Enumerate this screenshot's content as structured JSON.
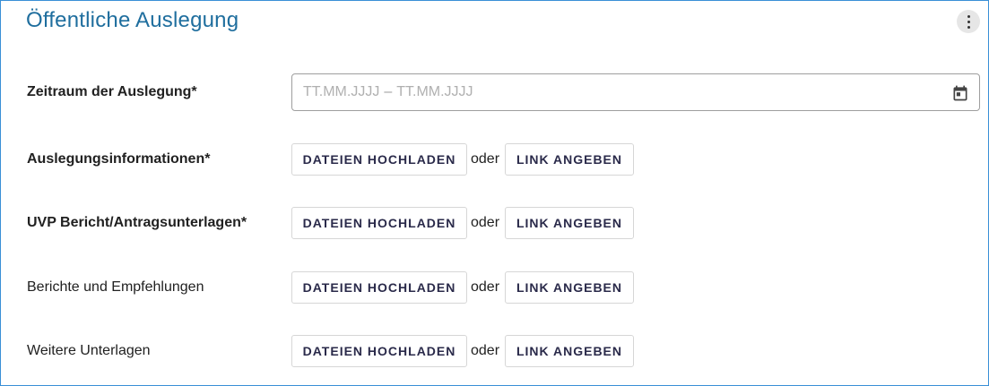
{
  "section": {
    "title": "Öffentliche Auslegung",
    "menu_icon": "more-vert-icon"
  },
  "period": {
    "label": "Zeitraum der Auslegung*",
    "start_placeholder": "TT.MM.JJJJ",
    "separator": "–",
    "end_placeholder": "TT.MM.JJJJ",
    "icon": "calendar-icon"
  },
  "uploads": [
    {
      "label": "Auslegungsinformationen*",
      "required": true,
      "upload_label": "DATEIEN HOCHLADEN",
      "or_label": "oder",
      "link_label": "LINK ANGEBEN"
    },
    {
      "label": "UVP Bericht/Antragsunterlagen*",
      "required": true,
      "upload_label": "DATEIEN HOCHLADEN",
      "or_label": "oder",
      "link_label": "LINK ANGEBEN"
    },
    {
      "label": "Berichte und Empfehlungen",
      "required": false,
      "upload_label": "DATEIEN HOCHLADEN",
      "or_label": "oder",
      "link_label": "LINK ANGEBEN"
    },
    {
      "label": "Weitere Unterlagen",
      "required": false,
      "upload_label": "DATEIEN HOCHLADEN",
      "or_label": "oder",
      "link_label": "LINK ANGEBEN"
    }
  ],
  "colors": {
    "title": "#1f6e9e",
    "card_border": "#3a8fd6",
    "button_text": "#2a2a4a"
  }
}
